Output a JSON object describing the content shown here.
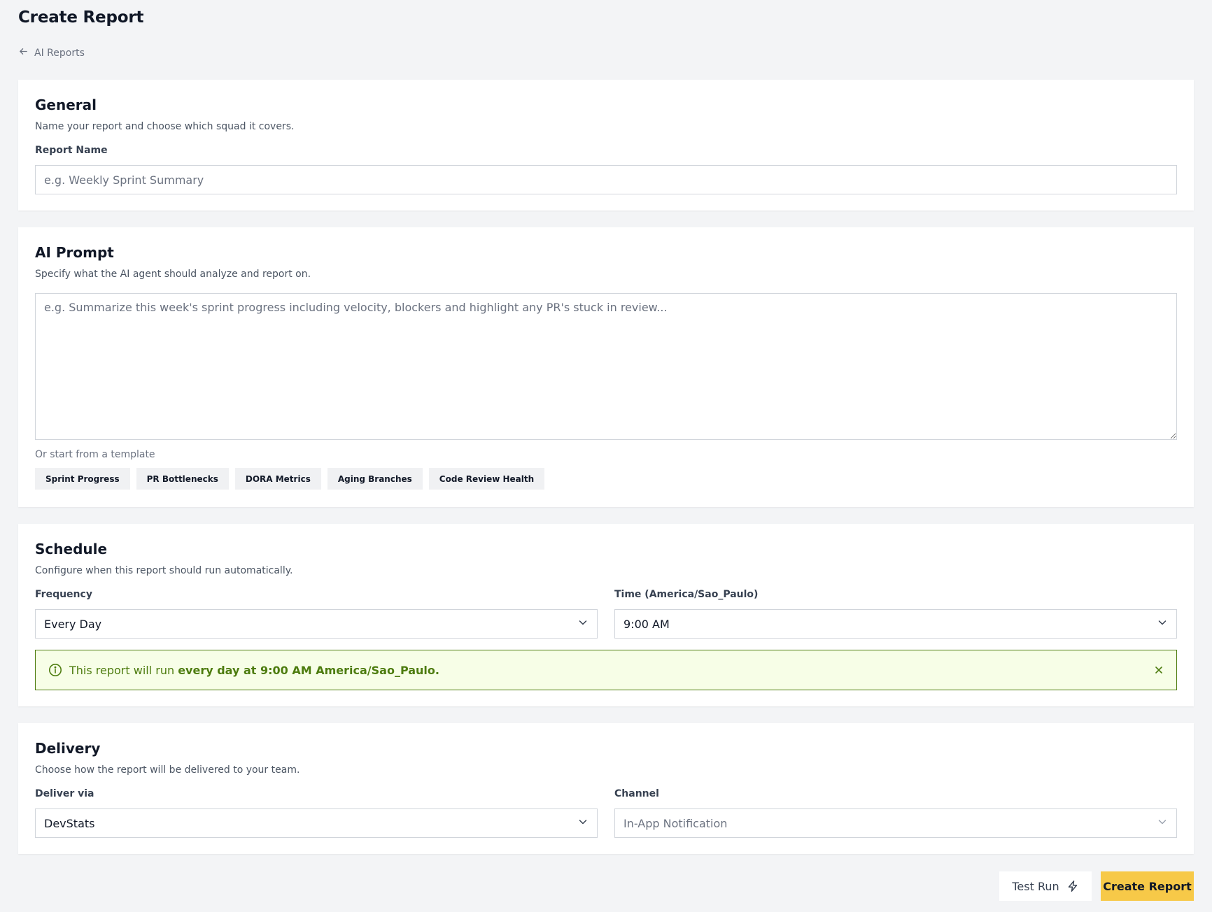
{
  "page": {
    "title": "Create Report",
    "breadcrumb_label": "AI Reports"
  },
  "general": {
    "title": "General",
    "description": "Name your report and choose which squad it covers.",
    "report_name_label": "Report Name",
    "report_name_value": "",
    "report_name_placeholder": "e.g. Weekly Sprint Summary"
  },
  "ai_prompt": {
    "title": "AI Prompt",
    "description": "Specify what the AI agent should analyze and report on.",
    "prompt_value": "",
    "prompt_placeholder": "e.g. Summarize this week's sprint progress including velocity, blockers and highlight any PR's stuck in review...",
    "template_hint": "Or start from a template",
    "templates": [
      "Sprint Progress",
      "PR Bottlenecks",
      "DORA Metrics",
      "Aging Branches",
      "Code Review Health"
    ]
  },
  "schedule": {
    "title": "Schedule",
    "description": "Configure when this report should run automatically.",
    "frequency_label": "Frequency",
    "frequency_value": "Every Day",
    "time_label": "Time (America/Sao_Paulo)",
    "time_value": "9:00 AM",
    "banner_prefix": "This report will run ",
    "banner_bold": "every day at 9:00 AM America/Sao_Paulo."
  },
  "delivery": {
    "title": "Delivery",
    "description": "Choose how the report will be delivered to your team.",
    "deliver_via_label": "Deliver via",
    "deliver_via_value": "DevStats",
    "channel_label": "Channel",
    "channel_value": "In-App Notification"
  },
  "actions": {
    "test_run_label": "Test Run",
    "create_label": "Create Report"
  },
  "icons": {
    "back": "arrow-left-icon",
    "chevron": "chevron-down-icon",
    "info": "info-circle-icon",
    "close": "close-icon",
    "test_run": "lightning-icon"
  },
  "colors": {
    "accent": "#f7c948",
    "banner_border": "#4d7c0f",
    "banner_bg": "#f7fee7",
    "page_bg": "#f3f4f6"
  }
}
